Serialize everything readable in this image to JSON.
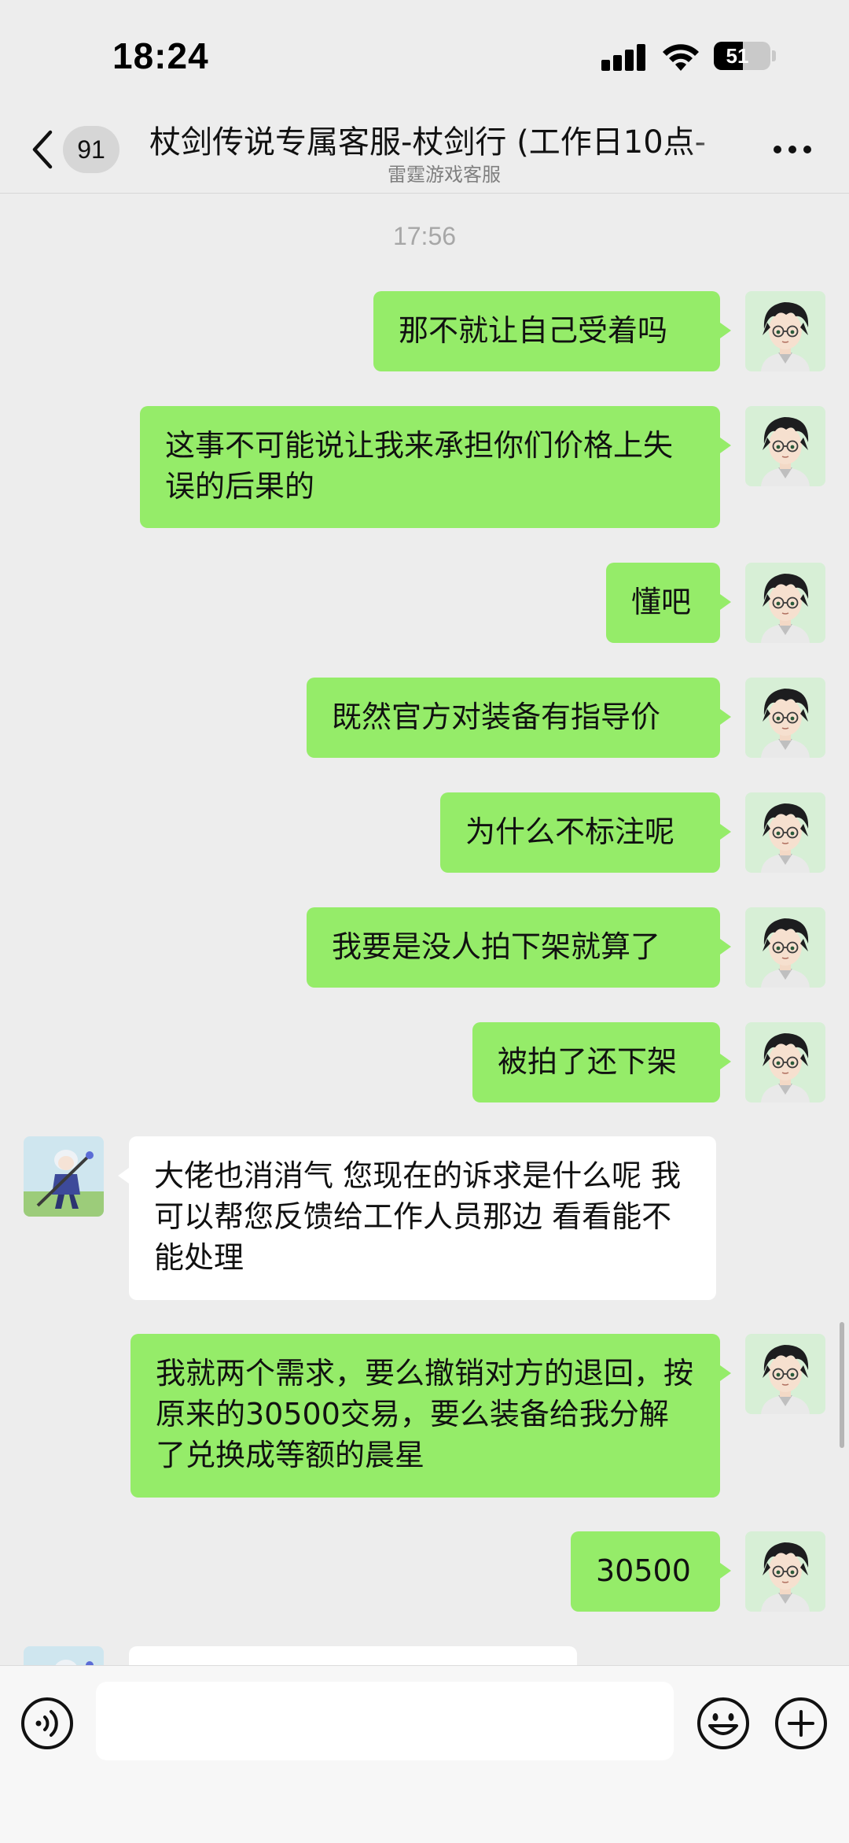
{
  "status_bar": {
    "time": "18:24",
    "battery_level": "51"
  },
  "nav": {
    "unread_count": "91",
    "title": "杖剑传说专属客服-杖剑行 (工作日10点-",
    "subtitle": "雷霆游戏客服"
  },
  "chat": {
    "timestamp": "17:56",
    "messages": [
      {
        "from": "me",
        "text": "那不就让自己受着吗"
      },
      {
        "from": "me",
        "text": "这事不可能说让我来承担你们价格上失误的后果的"
      },
      {
        "from": "me",
        "text": "懂吧"
      },
      {
        "from": "me",
        "text": "既然官方对装备有指导价"
      },
      {
        "from": "me",
        "text": "为什么不标注呢"
      },
      {
        "from": "me",
        "text": "我要是没人拍下架就算了"
      },
      {
        "from": "me",
        "text": "被拍了还下架"
      },
      {
        "from": "agent",
        "text": "大佬也消消气 您现在的诉求是什么呢 我可以帮您反馈给工作人员那边 看看能不能处理"
      },
      {
        "from": "me",
        "text": "我就两个需求，要么撤销对方的退回，按原来的30500交易，要么装备给我分解了兑换成等额的晨星"
      },
      {
        "from": "me",
        "text": "30500"
      }
    ]
  },
  "input": {
    "placeholder": ""
  },
  "colors": {
    "background": "#ededed",
    "outgoing_bubble": "#95ec69",
    "incoming_bubble": "#ffffff",
    "input_bar": "#f7f7f7"
  },
  "icons": {
    "back": "chevron-left-icon",
    "more": "more-dots-icon",
    "voice": "voice-icon",
    "emoji": "emoji-icon",
    "plus": "plus-icon"
  }
}
